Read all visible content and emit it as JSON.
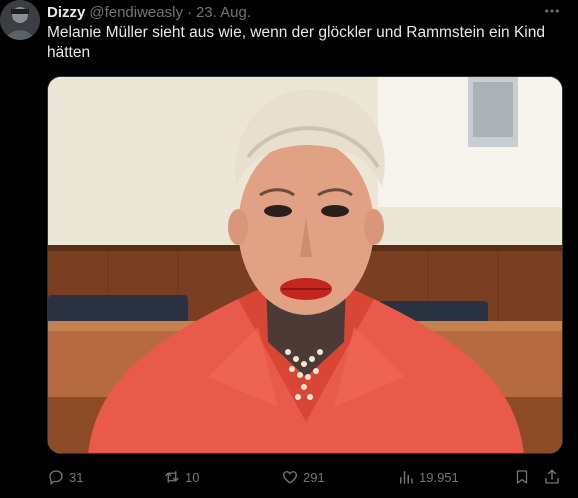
{
  "author": {
    "name": "Dizzy",
    "handle": "@fendiweasly",
    "separator": "·",
    "date": "23. Aug."
  },
  "tweet": {
    "text": "Melanie Müller sieht aus wie, wenn der glöckler und Rammstein ein Kind hätten"
  },
  "actions": {
    "replies": "31",
    "reposts": "10",
    "likes": "291",
    "views": "19.951"
  },
  "icons": {
    "more": "more-icon",
    "reply": "reply-icon",
    "repost": "repost-icon",
    "like": "heart-icon",
    "views": "views-icon",
    "bookmark": "bookmark-icon",
    "share": "share-icon"
  },
  "colors": {
    "background": "#000000",
    "text": "#e7e9ea",
    "muted": "#71767b",
    "border": "#2f3336"
  }
}
